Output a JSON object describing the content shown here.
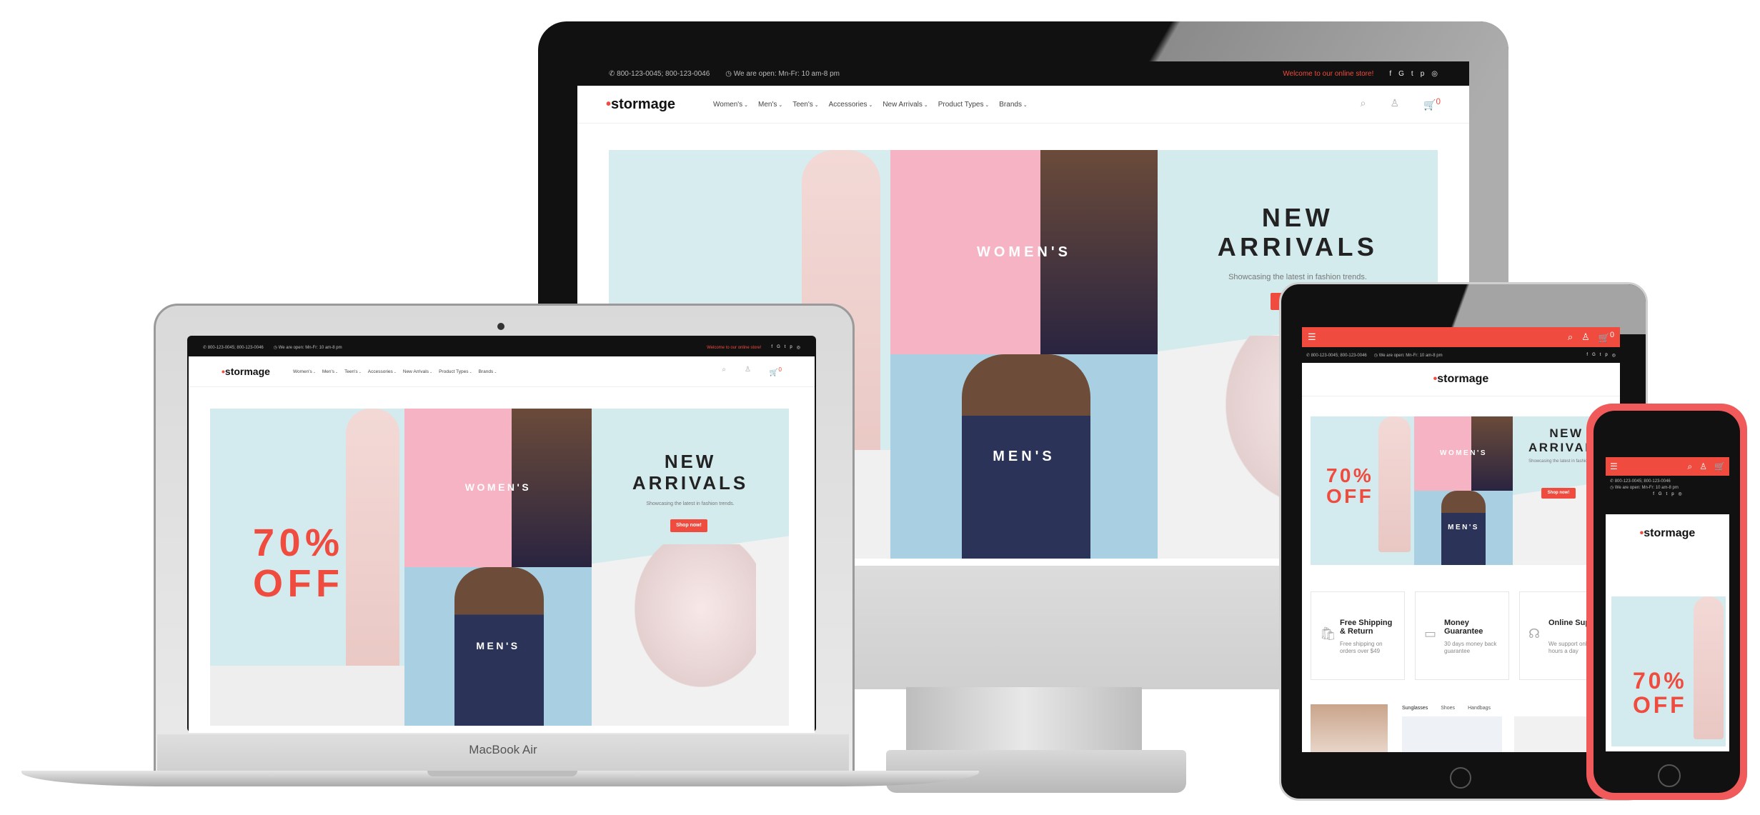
{
  "store": {
    "logo": "stormage",
    "logo_dot": "•",
    "phone": "800-123-0045; 800-123-0046",
    "hours": "We are open: Mn-Fr: 10 am-8 pm",
    "welcome": "Welcome to our online store!",
    "social": [
      "f",
      "G",
      "t",
      "p",
      "◎"
    ],
    "menu": [
      "Women's",
      "Men's",
      "Teen's",
      "Accessories",
      "New Arrivals",
      "Product Types",
      "Brands"
    ],
    "cart_count": "0"
  },
  "hero": {
    "women_label": "WOMEN'S",
    "men_label": "MEN'S",
    "new_arrivals_line1": "NEW",
    "new_arrivals_line2": "ARRIVALS",
    "subtitle": "Showcasing the latest in fashion trends.",
    "shop_button": "Shop now!",
    "sale_line1": "70%",
    "sale_line2": "OFF"
  },
  "devices": {
    "macbook_label": "MacBook Air"
  },
  "features": [
    {
      "title": "Free Shipping & Return",
      "text": "Free shipping on orders over $49"
    },
    {
      "title": "Money Guaranteе",
      "text": "30 days money back guarantee"
    },
    {
      "title": "Online Support",
      "text": "We support online 24 hours a day"
    }
  ],
  "product_tabs": [
    "Sunglasses",
    "Shoes",
    "Handbags"
  ],
  "colors": {
    "accent": "#ef4c3f",
    "women_bg": "#f7b6c4",
    "men_bg": "#a5cde0",
    "arrivals_bg": "#cfe8ea",
    "topbar": "#111111"
  }
}
